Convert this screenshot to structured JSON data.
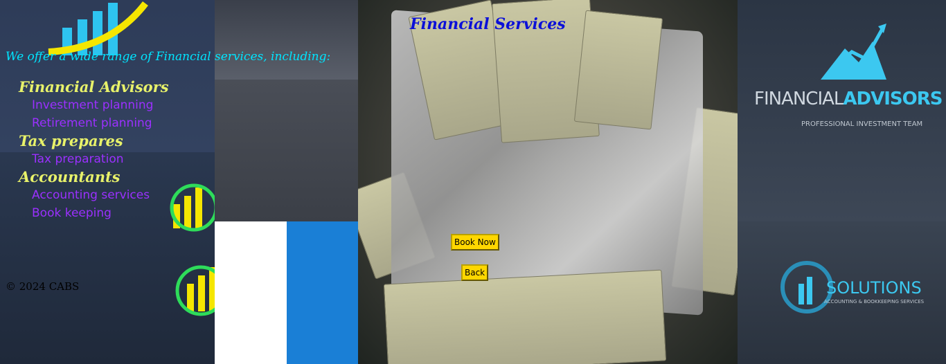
{
  "intro_text": "We offer a wide range of Financial services, including:",
  "services": [
    {
      "category": "Financial Advisors",
      "items": [
        "Investment planning",
        "Retirement planning"
      ]
    },
    {
      "category": "Tax prepares",
      "items": [
        "Tax preparation"
      ]
    },
    {
      "category": "Accountants",
      "items": [
        "Accounting services",
        "Book keeping"
      ]
    }
  ],
  "page_title": "Financial Services",
  "buttons": {
    "book_now": "Book Now",
    "back": "Back"
  },
  "footer": "© 2024 CABS",
  "background_logos": {
    "financial_advisors_word": "FINANCIAL",
    "financial_advisors_word_accent": "ADVISORS",
    "financial_advisors_sub": "PROFESSIONAL INVESTMENT TEAM",
    "solutions_word": "SOLUTIONS",
    "solutions_sub": "ACCOUNTING & BOOKKEEPING SERVICES"
  },
  "colors": {
    "intro": "#00e5ff",
    "category": "#e8f26a",
    "service_item": "#9b30ff",
    "title": "#0b10d8",
    "button_bg": "#ffd700"
  }
}
